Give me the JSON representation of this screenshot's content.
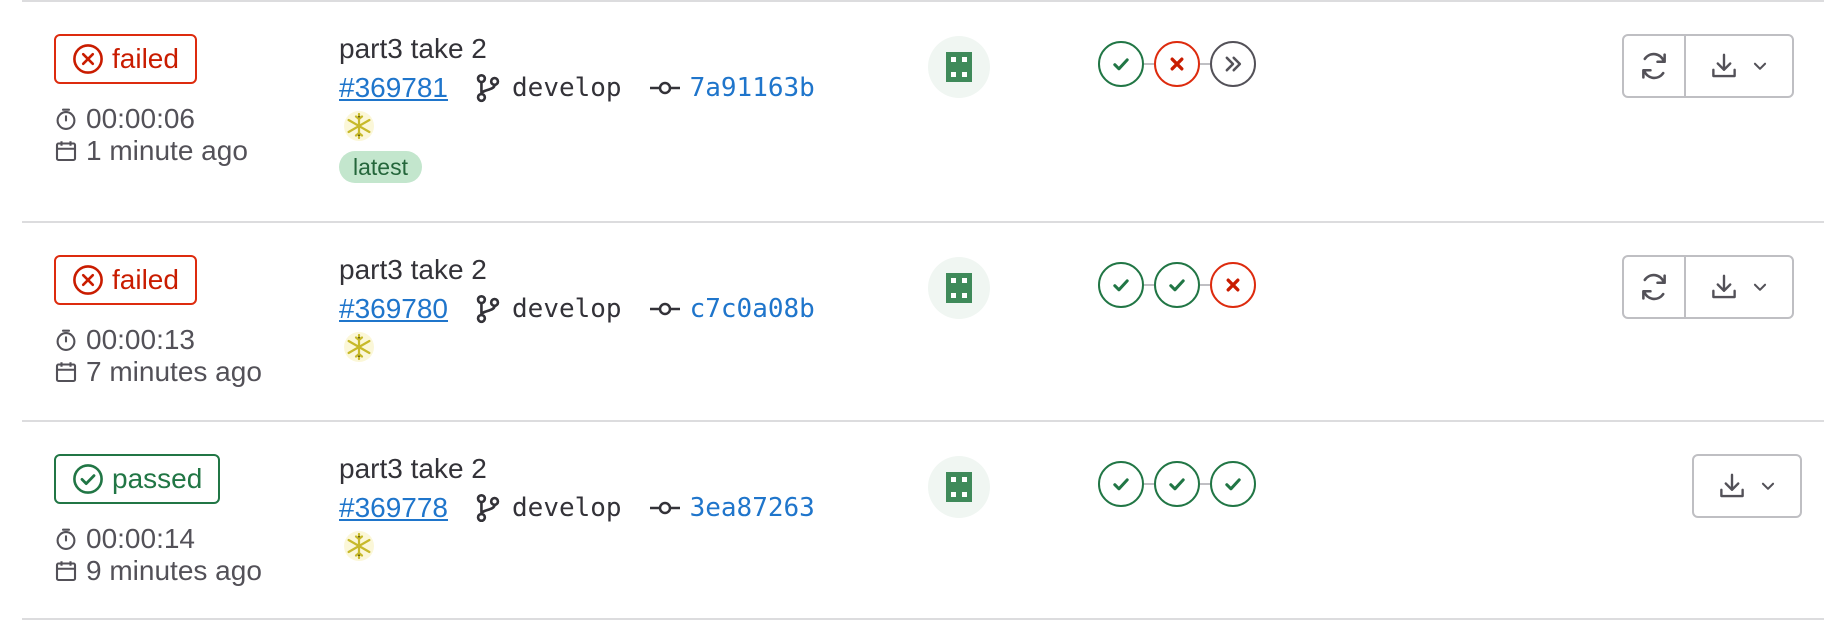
{
  "pipelines": [
    {
      "status": "failed",
      "status_label": "failed",
      "duration": "00:00:06",
      "finished": "1 minute ago",
      "commit_title": "part3 take 2",
      "pipeline_id": "#369781",
      "branch": "develop",
      "sha": "7a91163b",
      "latest_label": "latest",
      "stages": [
        "success",
        "failed",
        "skipped"
      ],
      "has_retry": true
    },
    {
      "status": "failed",
      "status_label": "failed",
      "duration": "00:00:13",
      "finished": "7 minutes ago",
      "commit_title": "part3 take 2",
      "pipeline_id": "#369780",
      "branch": "develop",
      "sha": "c7c0a08b",
      "stages": [
        "success",
        "success",
        "failed"
      ],
      "has_retry": true
    },
    {
      "status": "passed",
      "status_label": "passed",
      "duration": "00:00:14",
      "finished": "9 minutes ago",
      "commit_title": "part3 take 2",
      "pipeline_id": "#369778",
      "branch": "develop",
      "sha": "3ea87263",
      "stages": [
        "success",
        "success",
        "success"
      ],
      "has_retry": false
    }
  ],
  "colors": {
    "failed": "#dd2b0e",
    "success": "#217645",
    "link": "#1f75cb",
    "latest_bg": "#c3e6cd"
  },
  "icons": {
    "status_failed": "x-circle-icon",
    "status_passed": "check-circle-icon",
    "duration": "timer-icon",
    "finished": "calendar-icon",
    "branch": "branch-icon",
    "commit": "commit-icon",
    "trigger": "snowflake-icon",
    "retry": "retry-icon",
    "download": "download-icon"
  }
}
